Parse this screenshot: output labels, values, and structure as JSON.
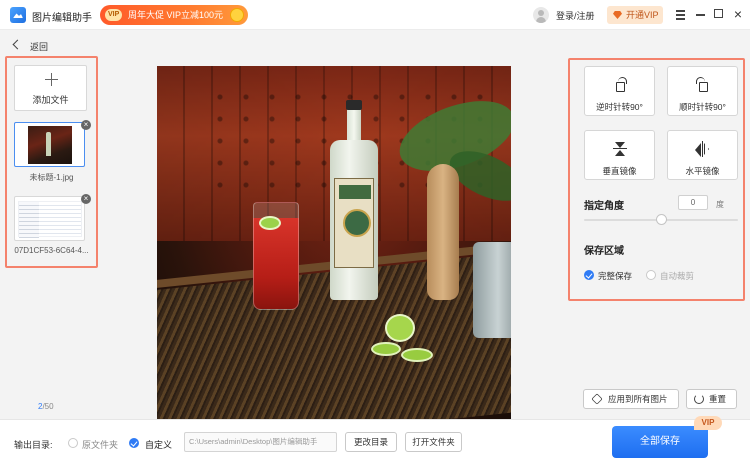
{
  "titlebar": {
    "app_title": "图片编辑助手",
    "promo_badge": "VIP",
    "promo_text": "周年大促 VIP立减100元",
    "login_label": "登录/注册",
    "open_vip_label": "开通VIP",
    "close_glyph": "×"
  },
  "nav": {
    "back_label": "返回"
  },
  "files": {
    "add_file_label": "添加文件",
    "items": [
      {
        "name": "未标题-1.jpg",
        "selected": true
      },
      {
        "name": "07D1CF53-6C64-4...",
        "selected": false
      }
    ],
    "remove_glyph": "×",
    "page_current": "2",
    "page_total": "/50"
  },
  "tools": {
    "rotate_ccw_label": "逆时针转90°",
    "rotate_cw_label": "顺时针转90°",
    "flip_vertical_label": "垂直镜像",
    "flip_horizontal_label": "水平镜像",
    "angle_label": "指定角度",
    "angle_value": "0",
    "angle_unit": "度",
    "angle_slider_fraction": 0.5,
    "save_area_label": "保存区域",
    "save_full_label": "完整保存",
    "save_auto_crop_label": "自动裁剪",
    "apply_all_label": "应用到所有图片",
    "reset_label": "重置"
  },
  "output": {
    "label": "输出目录:",
    "original_folder_label": "原文件夹",
    "custom_label": "自定义",
    "path": "C:\\Users\\admin\\Desktop\\图片编辑助手",
    "change_dir_label": "更改目录",
    "open_folder_label": "打开文件夹",
    "save_all_label": "全部保存",
    "vip_tag": "VIP"
  },
  "colors": {
    "accent": "#2f7bf5",
    "highlight_border": "#f4826c",
    "promo": "#ff5a2a"
  }
}
